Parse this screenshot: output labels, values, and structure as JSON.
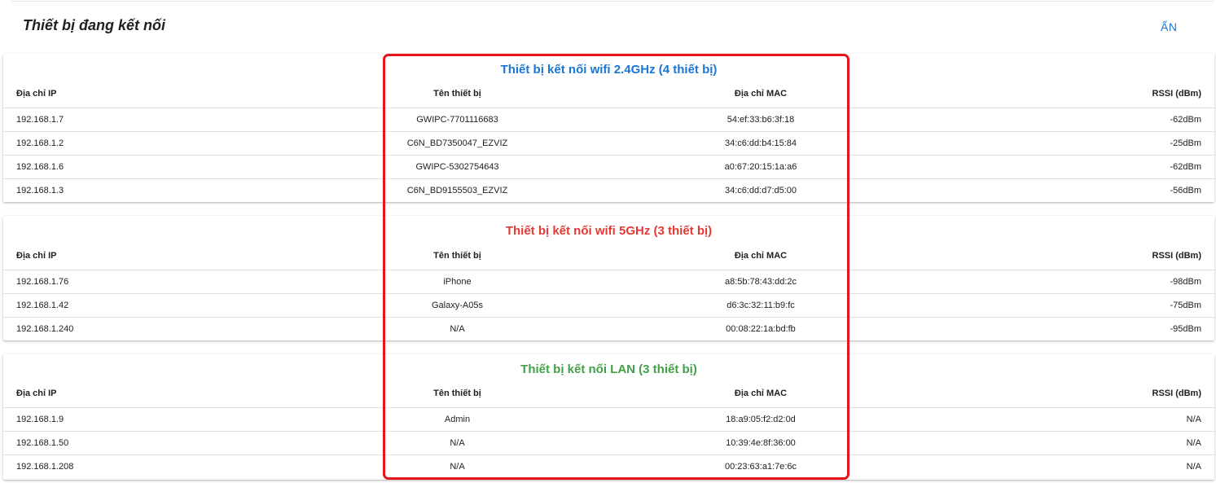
{
  "header": {
    "title": "Thiết bị đang kết nối",
    "hide_label": "ẨN"
  },
  "columns": {
    "ip": "Địa chỉ IP",
    "name": "Tên thiết bị",
    "mac": "Địa chỉ MAC",
    "rssi": "RSSI (dBm)"
  },
  "colors": {
    "wifi24_title": "#1976d2",
    "wifi5_title": "#e53935",
    "lan_title": "#43a047",
    "highlight_border": "#e8141b",
    "hide_link": "#1976d2"
  },
  "wifi24": {
    "title": "Thiết bị kết nối wifi 2.4GHz (4 thiết bị)",
    "rows": [
      {
        "ip": "192.168.1.7",
        "name": "GWIPC-7701116683",
        "mac": "54:ef:33:b6:3f:18",
        "rssi": "-62dBm"
      },
      {
        "ip": "192.168.1.2",
        "name": "C6N_BD7350047_EZVIZ",
        "mac": "34:c6:dd:b4:15:84",
        "rssi": "-25dBm"
      },
      {
        "ip": "192.168.1.6",
        "name": "GWIPC-5302754643",
        "mac": "a0:67:20:15:1a:a6",
        "rssi": "-62dBm"
      },
      {
        "ip": "192.168.1.3",
        "name": "C6N_BD9155503_EZVIZ",
        "mac": "34:c6:dd:d7:d5:00",
        "rssi": "-56dBm"
      }
    ]
  },
  "wifi5": {
    "title": "Thiết bị kết nối wifi 5GHz (3 thiết bị)",
    "rows": [
      {
        "ip": "192.168.1.76",
        "name": "iPhone",
        "mac": "a8:5b:78:43:dd:2c",
        "rssi": "-98dBm"
      },
      {
        "ip": "192.168.1.42",
        "name": "Galaxy-A05s",
        "mac": "d6:3c:32:11:b9:fc",
        "rssi": "-75dBm"
      },
      {
        "ip": "192.168.1.240",
        "name": "N/A",
        "mac": "00:08:22:1a:bd:fb",
        "rssi": "-95dBm"
      }
    ]
  },
  "lan": {
    "title": "Thiết bị kết nối LAN (3 thiết bị)",
    "rows": [
      {
        "ip": "192.168.1.9",
        "name": "Admin",
        "mac": "18:a9:05:f2:d2:0d",
        "rssi": "N/A"
      },
      {
        "ip": "192.168.1.50",
        "name": "N/A",
        "mac": "10:39:4e:8f:36:00",
        "rssi": "N/A"
      },
      {
        "ip": "192.168.1.208",
        "name": "N/A",
        "mac": "00:23:63:a1:7e:6c",
        "rssi": "N/A"
      }
    ]
  }
}
